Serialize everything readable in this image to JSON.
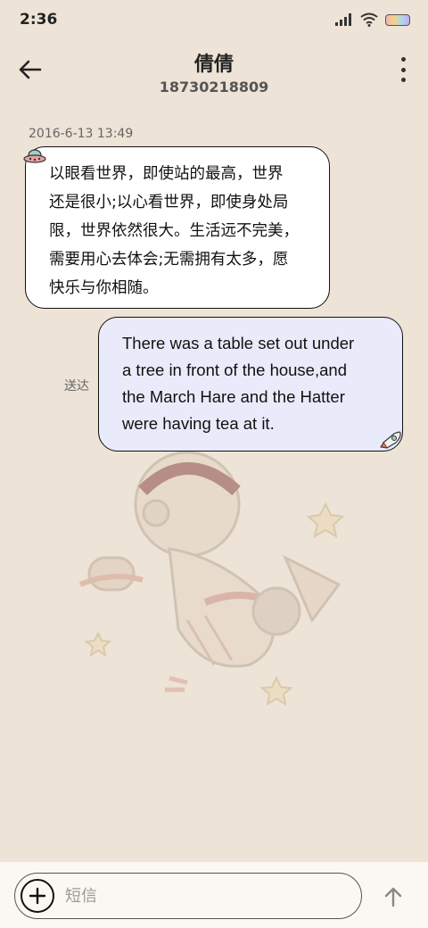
{
  "status_bar": {
    "time": "2:36",
    "icons": [
      "signal-icon",
      "wifi-icon",
      "battery-icon"
    ]
  },
  "header": {
    "contact_name": "倩倩",
    "contact_number": "18730218809",
    "icons": [
      "back-arrow-icon",
      "more-vertical-icon"
    ]
  },
  "conversation": {
    "timestamp": "2016-6-13 13:49",
    "messages": [
      {
        "direction": "incoming",
        "lines": [
          "以眼看世界，即使站的最高，世界",
          "还是很小;以心看世界，即使身处局",
          "限，世界依然很大。生活远不完美，",
          "需要用心去体会;无需拥有太多，愿",
          "快乐与你相随。"
        ]
      },
      {
        "direction": "outgoing",
        "status": "送达",
        "lines": [
          "There was a table set out under",
          "a tree in front of the house,and",
          "the March Hare and the Hatter",
          "were having tea at it."
        ]
      }
    ]
  },
  "composer": {
    "placeholder": "短信",
    "value": "",
    "icons": [
      "add-icon",
      "send-arrow-icon"
    ]
  },
  "colors": {
    "background": "#ede3d6",
    "incoming_bubble": "#ffffff",
    "outgoing_bubble": "#e9ebfb",
    "bottom_bar": "#fbf8f3"
  }
}
